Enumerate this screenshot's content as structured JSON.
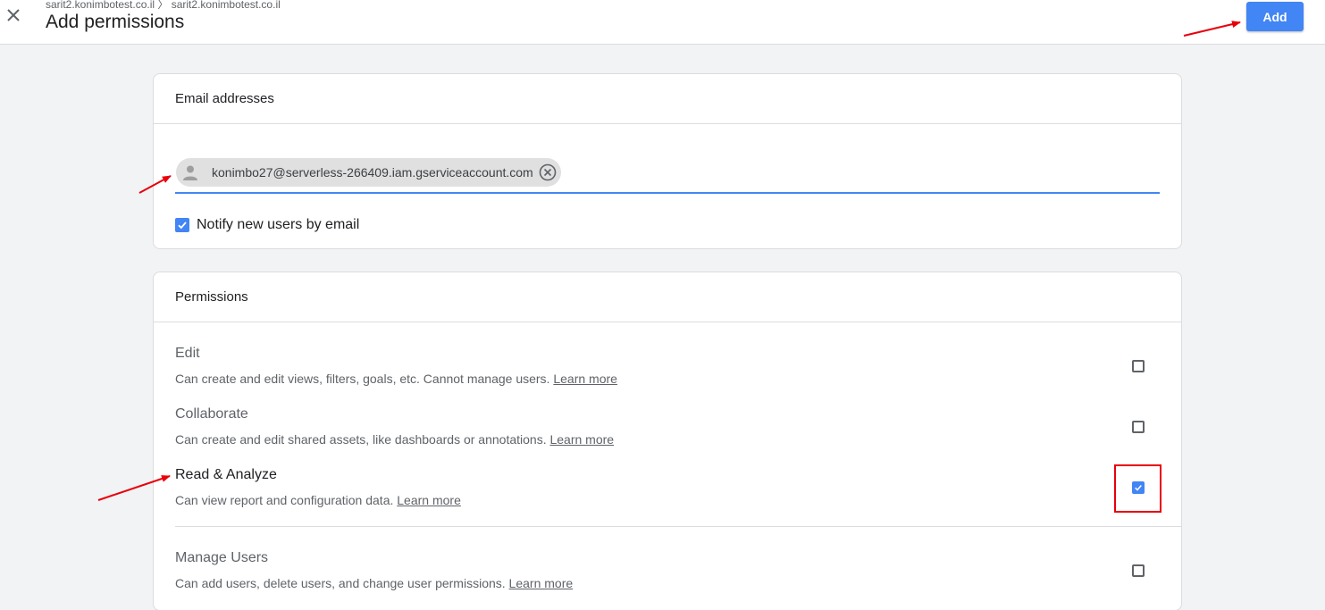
{
  "header": {
    "breadcrumb": "sarit2.konimbotest.co.il 〉 sarit2.konimbotest.co.il",
    "title": "Add permissions",
    "add_label": "Add"
  },
  "email_section": {
    "title": "Email addresses",
    "chip_email": "konimbo27@serverless-266409.iam.gserviceaccount.com",
    "notify_label": "Notify new users by email",
    "notify_checked": true
  },
  "permissions_section": {
    "title": "Permissions",
    "items": [
      {
        "title": "Edit",
        "description": "Can create and edit views, filters, goals, etc. Cannot manage users.",
        "link": "Learn more",
        "checked": false
      },
      {
        "title": "Collaborate",
        "description": "Can create and edit shared assets, like dashboards or annotations.",
        "link": "Learn more",
        "checked": false
      },
      {
        "title": "Read & Analyze",
        "description": "Can view report and configuration data.",
        "link": "Learn more",
        "checked": true
      },
      {
        "title": "Manage Users",
        "description": "Can add users, delete users, and change user permissions.",
        "link": "Learn more",
        "checked": false
      }
    ]
  },
  "colors": {
    "accent": "#4285f4",
    "annotation_red": "#e8000b",
    "background": "#f1f3f4"
  },
  "icons": {
    "close": "close-icon",
    "avatar": "person-icon",
    "chip_remove": "cancel-circle-icon",
    "check": "check-icon"
  }
}
